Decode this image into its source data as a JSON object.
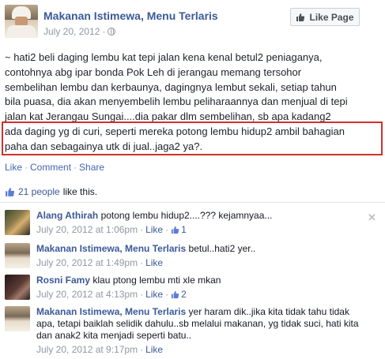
{
  "post": {
    "page_name": "Makanan Istimewa, Menu Terlaris",
    "date": "July 20, 2012",
    "like_page_label": "Like Page",
    "text_lines": [
      "~ hati2 beli daging lembu kat tepi jalan kena kenal betul2 peniaganya,",
      "contohnya abg ipar bonda Pok Leh di jerangau memang tersohor",
      "sembelihan lembu dan kerbaunya, dagingnya lembut sekali, setiap tahun",
      "bila puasa, dia akan menyembelih lembu peliharaannya dan menjual di tepi",
      "jalan kat Jerangau Sungai....dia pakar dlm sembelihan, sb apa kadang2",
      "ada daging yg di curi, seperti mereka potong lembu hidup2 ambil bahagian",
      "paha dan sebagainya utk di jual..jaga2 ya?."
    ],
    "actions": {
      "like": "Like",
      "comment": "Comment",
      "share": "Share"
    },
    "likes": {
      "count_link": "21 people",
      "suffix": "like this."
    }
  },
  "comments": [
    {
      "author": "Alang Athirah",
      "text": "potong lembu hidup2....??? kejamnyaa...",
      "time": "July 20, 2012 at 1:06pm",
      "like_label": "Like",
      "like_count": "1",
      "avatar_icon": "user-photo-alang"
    },
    {
      "author": "Makanan Istimewa, Menu Terlaris",
      "text": "betul..hati2 yer..",
      "time": "July 20, 2012 at 1:49pm",
      "like_label": "Like",
      "like_count": "",
      "avatar_icon": "page-photo"
    },
    {
      "author": "Rosni Famy",
      "text": "klau ptong lembu mti xle mkan",
      "time": "July 20, 2012 at 4:13pm",
      "like_label": "Like",
      "like_count": "2",
      "avatar_icon": "user-photo-rosni"
    },
    {
      "author": "Makanan Istimewa, Menu Terlaris",
      "text_lines": [
        "yer haram dik..jika kita tidak tahu tidak",
        "apa, tetapi baiklah selidik dahulu..sb melalui makanan, yg tidak suci, hati kita",
        "dan anak2 kita menjadi seperti batu.."
      ],
      "time": "July 20, 2012 at 9:17pm",
      "like_label": "Like",
      "like_count": "",
      "avatar_icon": "page-photo"
    }
  ],
  "colors": {
    "link": "#3b5998",
    "highlight": "#d0312d",
    "meta": "#9197a3"
  }
}
